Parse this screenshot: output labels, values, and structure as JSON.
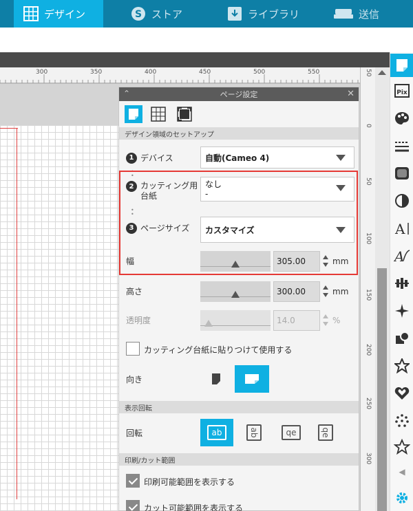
{
  "topbar": {
    "tabs": [
      {
        "label": "デザイン",
        "active": true
      },
      {
        "label": "ストア",
        "active": false
      },
      {
        "label": "ライブラリ",
        "active": false
      },
      {
        "label": "送信",
        "active": false
      }
    ]
  },
  "ruler": {
    "top_ticks": [
      "300",
      "350",
      "400",
      "450",
      "500",
      "550"
    ],
    "right_ticks": [
      "50",
      "0",
      "50",
      "100",
      "150",
      "200",
      "250",
      "300"
    ]
  },
  "panel": {
    "title": "ページ設定",
    "section_setup": "デザイン領域のセットアップ",
    "device": {
      "num": "1",
      "label": "デバイス",
      "value": "自動(Cameo 4)"
    },
    "mat": {
      "num": "2",
      "label_line1": "カッティング用",
      "label_line2": "台紙",
      "value_line1": "なし",
      "value_line2": "-"
    },
    "page_size": {
      "num": "3",
      "label": "ページサイズ",
      "value": "カスタマイズ"
    },
    "width": {
      "label": "幅",
      "value": "305.00",
      "unit": "mm"
    },
    "height": {
      "label": "高さ",
      "value": "300.00",
      "unit": "mm"
    },
    "opacity": {
      "label": "透明度",
      "value": "14.0",
      "unit": "%"
    },
    "use_mat_checkbox": {
      "label": "カッティング台紙に貼りつけて使用する",
      "checked": false
    },
    "orientation": {
      "label": "向き"
    },
    "section_rotation": "表示回転",
    "rotation": {
      "label": "回転",
      "glyphs": [
        "ab",
        "ab",
        "qe",
        "qe"
      ]
    },
    "section_print": "印刷/カット範囲",
    "show_print_area": {
      "label": "印刷可能範囲を表示する",
      "checked": true
    },
    "show_cut_area": {
      "label": "カット可能範囲を表示する",
      "checked": true
    }
  },
  "colors": {
    "accent": "#0fb0e2",
    "topbar": "#0e7fa6",
    "highlight": "#e53935"
  }
}
